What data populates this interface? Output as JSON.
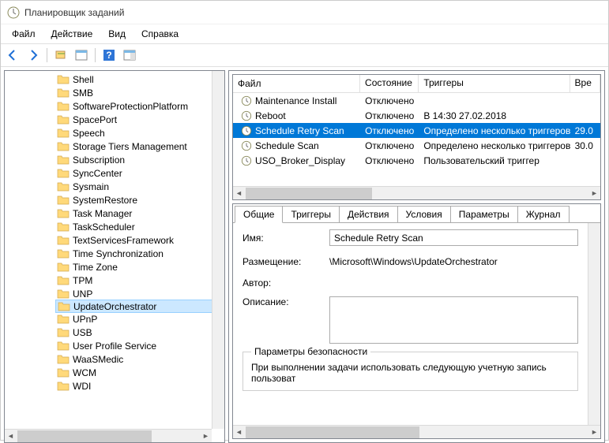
{
  "window": {
    "title": "Планировщик заданий"
  },
  "menu": {
    "file": "Файл",
    "action": "Действие",
    "view": "Вид",
    "help": "Справка"
  },
  "tree": {
    "items": [
      "Shell",
      "SMB",
      "SoftwareProtectionPlatform",
      "SpacePort",
      "Speech",
      "Storage Tiers Management",
      "Subscription",
      "SyncCenter",
      "Sysmain",
      "SystemRestore",
      "Task Manager",
      "TaskScheduler",
      "TextServicesFramework",
      "Time Synchronization",
      "Time Zone",
      "TPM",
      "UNP",
      "UpdateOrchestrator",
      "UPnP",
      "USB",
      "User Profile Service",
      "WaaSMedic",
      "WCM",
      "WDI"
    ],
    "selected": "UpdateOrchestrator"
  },
  "list": {
    "columns": {
      "file": "Файл",
      "state": "Состояние",
      "triggers": "Триггеры",
      "next": "Вре"
    },
    "rows": [
      {
        "name": "Maintenance Install",
        "state": "Отключено",
        "trigger": "",
        "next": ""
      },
      {
        "name": "Reboot",
        "state": "Отключено",
        "trigger": "В 14:30 27.02.2018",
        "next": ""
      },
      {
        "name": "Schedule Retry Scan",
        "state": "Отключено",
        "trigger": "Определено несколько триггеров",
        "next": "29.0"
      },
      {
        "name": "Schedule Scan",
        "state": "Отключено",
        "trigger": "Определено несколько триггеров",
        "next": "30.0"
      },
      {
        "name": "USO_Broker_Display",
        "state": "Отключено",
        "trigger": "Пользовательский триггер",
        "next": ""
      }
    ],
    "selected": 2
  },
  "tabs": {
    "general": "Общие",
    "triggers": "Триггеры",
    "actions": "Действия",
    "conditions": "Условия",
    "settings": "Параметры",
    "history": "Журнал"
  },
  "detail": {
    "name_label": "Имя:",
    "name_value": "Schedule Retry Scan",
    "loc_label": "Размещение:",
    "loc_value": "\\Microsoft\\Windows\\UpdateOrchestrator",
    "author_label": "Автор:",
    "author_value": "",
    "desc_label": "Описание:",
    "security_legend": "Параметры безопасности",
    "security_text": "При выполнении задачи использовать следующую учетную запись пользоват"
  }
}
